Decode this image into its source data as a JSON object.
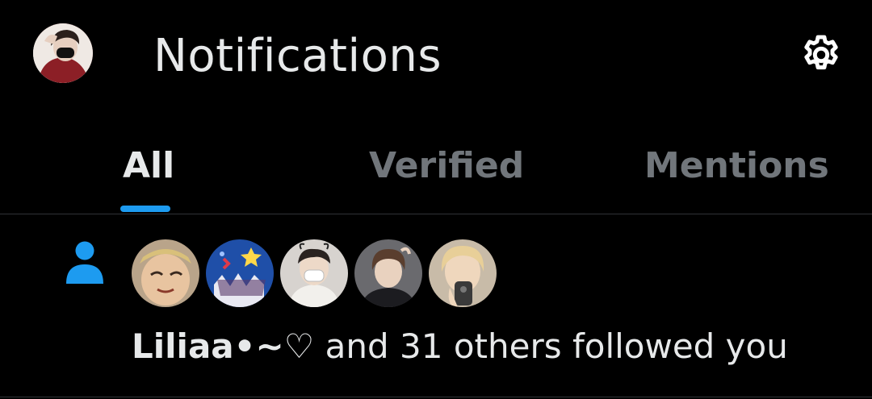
{
  "header": {
    "title": "Notifications",
    "profile_avatar_icon": "profile-avatar",
    "settings_icon": "gear-icon"
  },
  "tabs": [
    {
      "label": "All",
      "selected": true
    },
    {
      "label": "Verified",
      "selected": false
    },
    {
      "label": "Mentions",
      "selected": false
    }
  ],
  "colors": {
    "background": "#000000",
    "text_primary": "#e7e9ea",
    "text_secondary": "#71767b",
    "accent": "#1d9bf0",
    "divider": "#2f3336"
  },
  "notification": {
    "type_icon": "person-icon",
    "avatar_count_shown": 5,
    "name": "Liliaa•~♡",
    "rest": " and 31 others followed you"
  }
}
